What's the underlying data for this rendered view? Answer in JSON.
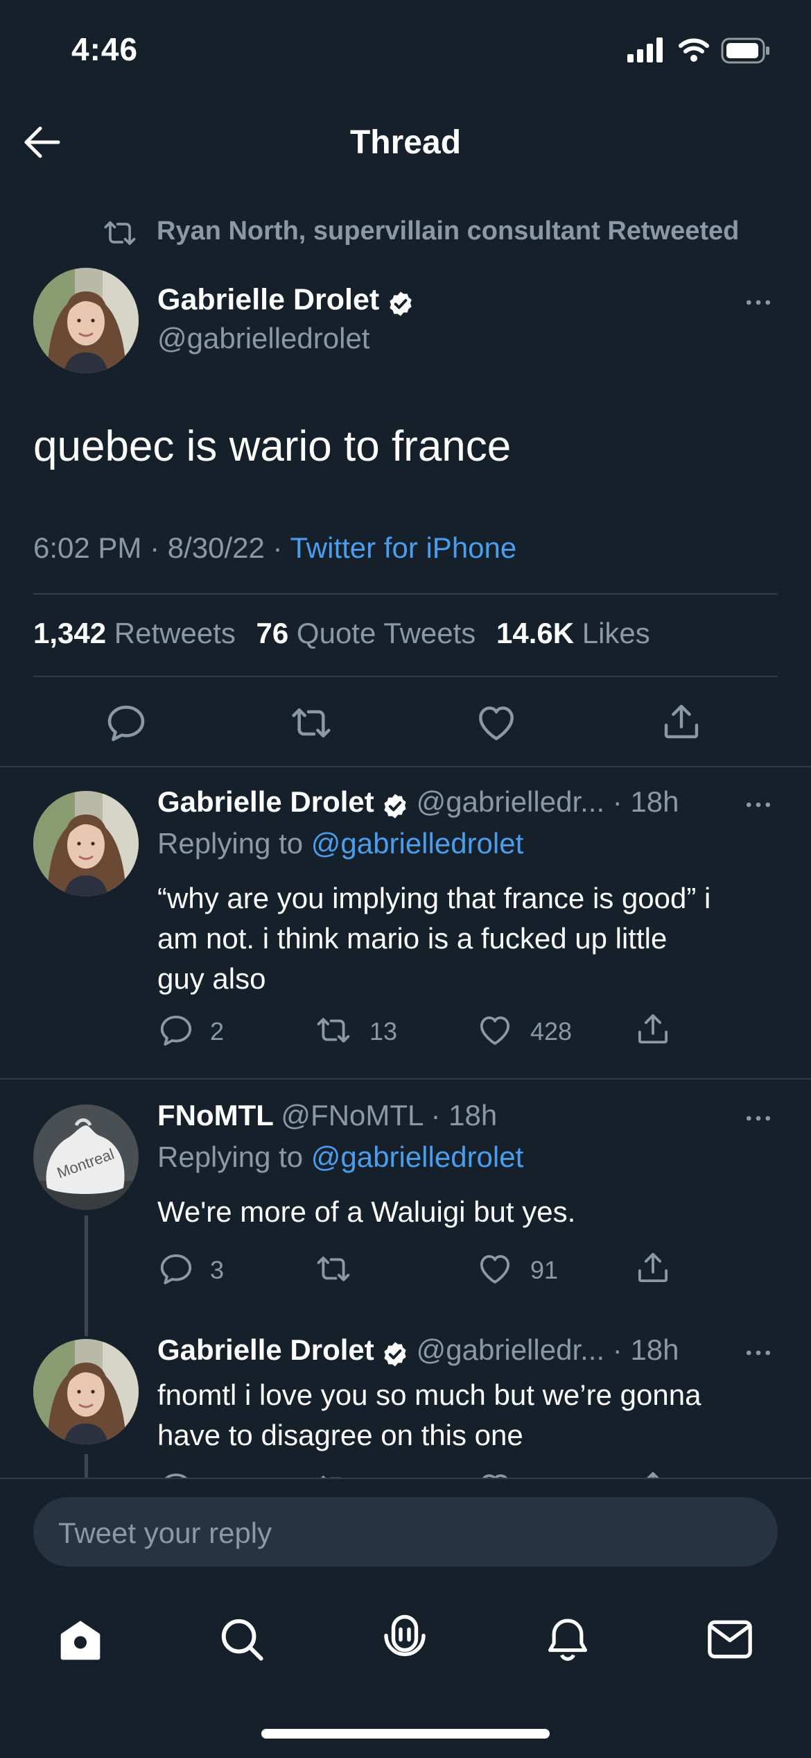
{
  "status_bar": {
    "time": "4:46"
  },
  "nav": {
    "title": "Thread"
  },
  "retweet_context": {
    "text": "Ryan North, supervillain consultant Retweeted"
  },
  "main_tweet": {
    "author": "Gabrielle Drolet",
    "handle": "@gabrielledrolet",
    "text": "quebec is wario to france",
    "time": "6:02 PM · 8/30/22 · ",
    "source": "Twitter for iPhone",
    "stats": {
      "retweets_count": "1,342",
      "retweets_label": "Retweets",
      "quotes_count": "76",
      "quotes_label": "Quote Tweets",
      "likes_count": "14.6K",
      "likes_label": "Likes"
    }
  },
  "replies": [
    {
      "author": "Gabrielle Drolet",
      "meta": "@gabrielledr... · 18h",
      "replying_label": "Replying to ",
      "replying_handle": "@gabrielledrolet",
      "text_lines": [
        "“why are you implying that france is good” i",
        "am not. i think mario is a fucked up little",
        "guy also"
      ],
      "replies": "2",
      "retweets": "13",
      "likes": "428"
    },
    {
      "author": "FNoMTL",
      "meta": "@FNoMTL · 18h",
      "replying_label": "Replying to ",
      "replying_handle": "@gabrielledrolet",
      "text_lines": [
        "We're more of a Waluigi but yes."
      ],
      "replies": "3",
      "retweets": "",
      "likes": "91"
    },
    {
      "author": "Gabrielle Drolet",
      "meta": "@gabrielledr... · 18h",
      "text_lines": [
        "fnomtl i love you so much but we’re gonna",
        "have to disagree on this one"
      ]
    }
  ],
  "reply_box": {
    "placeholder": "Tweet your reply"
  },
  "avatar_bag_text": "Montreal",
  "tab_bar": [
    "home-icon",
    "search-icon",
    "spaces-icon",
    "notifications-icon",
    "messages-icon"
  ],
  "colors": {
    "background": "#15202b",
    "accent": "#1d9bf0",
    "link": "#4a9eed",
    "muted": "#8b98a5"
  }
}
